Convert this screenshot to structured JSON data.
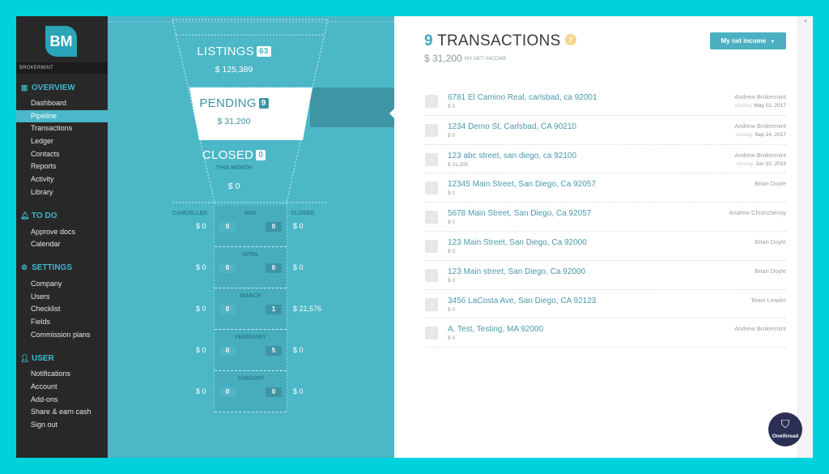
{
  "sidebar": {
    "logo": "BM",
    "brand": "BROKERMINT",
    "sections": [
      {
        "title": "OVERVIEW",
        "icon": "chart-icon",
        "items": [
          "Dashboard",
          "Pipeline",
          "Transactions",
          "Ledger",
          "Contacts",
          "Reports",
          "Activity",
          "Library"
        ],
        "active": "Pipeline"
      },
      {
        "title": "TO DO",
        "icon": "bell-icon",
        "items": [
          "Approve docs",
          "Calendar"
        ]
      },
      {
        "title": "SETTINGS",
        "icon": "gear-icon",
        "items": [
          "Company",
          "Users",
          "Checklist",
          "Fields",
          "Commission plans"
        ]
      },
      {
        "title": "USER",
        "icon": "user-icon",
        "items": [
          "Notifications",
          "Account",
          "Add-ons",
          "Share & earn cash",
          "Sign out"
        ]
      }
    ]
  },
  "funnel": {
    "listings": {
      "label": "LISTINGS",
      "count": "63",
      "amount": "$ 125,389"
    },
    "pending": {
      "label": "PENDING",
      "count": "9",
      "amount": "$ 31,200"
    },
    "closed": {
      "label": "CLOSED",
      "count": "0",
      "sublabel": "THIS MONTH",
      "amount": "$ 0"
    },
    "cancelled_header": "CANCELLED",
    "closed_header": "CLOSED",
    "months": [
      {
        "name": "MAY",
        "cancelled_count": "0",
        "closed_count": "0",
        "cancelled_amount": "$ 0",
        "closed_amount": "$ 0"
      },
      {
        "name": "APRIL",
        "cancelled_count": "0",
        "closed_count": "0",
        "cancelled_amount": "$ 0",
        "closed_amount": "$ 0"
      },
      {
        "name": "MARCH",
        "cancelled_count": "0",
        "closed_count": "1",
        "cancelled_amount": "$ 0",
        "closed_amount": "$ 21,576"
      },
      {
        "name": "FEBRUARY",
        "cancelled_count": "0",
        "closed_count": "5",
        "cancelled_amount": "$ 0",
        "closed_amount": "$ 0"
      },
      {
        "name": "JANUARY",
        "cancelled_count": "0",
        "closed_count": "0",
        "cancelled_amount": "$ 0",
        "closed_amount": "$ 0"
      }
    ]
  },
  "main": {
    "count": "9",
    "title": "TRANSACTIONS",
    "help": "?",
    "income_amount": "$ 31,200",
    "income_label": "MY NET INCOME",
    "dropdown_label": "My net income",
    "closing_label": "closing:",
    "transactions": [
      {
        "address": "6781 El Camino Real, carlsbad, ca 92001",
        "amount": "$ 0",
        "agent": "Andrew Brokermint",
        "closing": "May 02, 2017"
      },
      {
        "address": "1234 Demo St, Carlsbad, CA 90210",
        "amount": "$ 0",
        "agent": "Andrew Brokermint",
        "closing": "Sep 14, 2017"
      },
      {
        "address": "123 abc street, san diego, ca 92100",
        "amount": "$ 31,200",
        "agent": "Andrew Brokermint",
        "closing": "Jun 10, 2018"
      },
      {
        "address": "12345 Main Street, San Diego, Ca 92057",
        "amount": "$ 0",
        "agent": "Brian Doyle",
        "closing": ""
      },
      {
        "address": "5678 Main Street, San Diego, Ca 92057",
        "amount": "$ 0",
        "agent": "Andrew Chishchevoy",
        "closing": ""
      },
      {
        "address": "123 Main Street, San Diego, Ca 92000",
        "amount": "$ 0",
        "agent": "Brian Doyle",
        "closing": ""
      },
      {
        "address": "123 Main street, San Diego, Ca 92000",
        "amount": "$ 0",
        "agent": "Brian Doyle",
        "closing": ""
      },
      {
        "address": "3456 LaCosta Ave, San Diego, CA 92123",
        "amount": "$ 0",
        "agent": "Team Leader",
        "closing": ""
      },
      {
        "address": "A. Test, Testing, MA 92000",
        "amount": "$ 0",
        "agent": "Andrew Brokermint",
        "closing": ""
      }
    ]
  },
  "watermark": {
    "label": "Onethread"
  },
  "colors": {
    "accent": "#4bb7c7",
    "sidebar": "#282828",
    "frame": "#00d2dd",
    "pending": "#3e95a4",
    "help": "#f6d48a"
  }
}
